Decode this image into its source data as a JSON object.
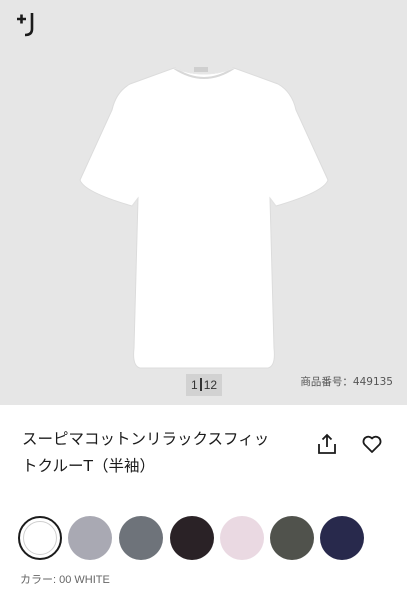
{
  "gallery": {
    "brand_logo_icon": "plus-j-logo-icon",
    "image_index": "1",
    "image_total": "12",
    "item_number_label": "商品番号：",
    "item_number": "449135"
  },
  "product": {
    "title_line1": "スーピマコットンリラックスフィッ",
    "title_line2": "トクルーT（半袖）"
  },
  "actions": {
    "share_icon": "share-icon",
    "favorite_icon": "heart-icon"
  },
  "colors": {
    "swatches": [
      {
        "hex": "#ffffff",
        "selected": true
      },
      {
        "hex": "#a9a9b3"
      },
      {
        "hex": "#6e737a"
      },
      {
        "hex": "#2a2226"
      },
      {
        "hex": "#ead9e2"
      },
      {
        "hex": "#50524c"
      },
      {
        "hex": "#28294c"
      }
    ],
    "label": "カラー: 00 WHITE"
  }
}
